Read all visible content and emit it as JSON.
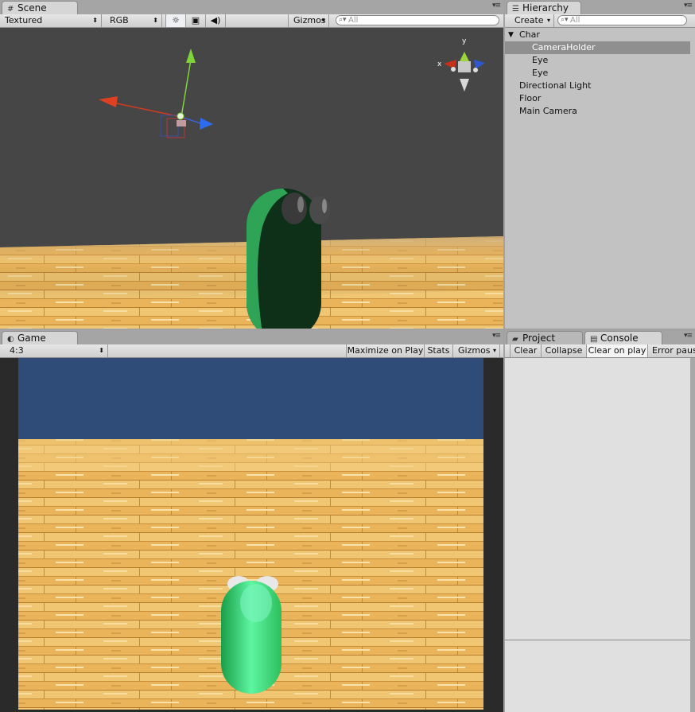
{
  "scene": {
    "tab_label": "Scene",
    "render_mode": "Textured",
    "color_mode": "RGB",
    "gizmos_label": "Gizmos",
    "search_placeholder": "All",
    "axis_x": "x",
    "axis_y": "y"
  },
  "hierarchy": {
    "tab_label": "Hierarchy",
    "create_label": "Create",
    "search_placeholder": "All",
    "items": [
      {
        "label": "Char",
        "indent": 0,
        "expanded": true
      },
      {
        "label": "CameraHolder",
        "indent": 1,
        "selected": true
      },
      {
        "label": "Eye",
        "indent": 1
      },
      {
        "label": "Eye",
        "indent": 1
      },
      {
        "label": "Directional Light",
        "indent": 0
      },
      {
        "label": "Floor",
        "indent": 0
      },
      {
        "label": "Main Camera",
        "indent": 0
      }
    ]
  },
  "game": {
    "tab_label": "Game",
    "aspect": "4:3",
    "maximize_label": "Maximize on Play",
    "stats_label": "Stats",
    "gizmos_label": "Gizmos"
  },
  "project": {
    "tab_label": "Project"
  },
  "console": {
    "tab_label": "Console",
    "clear_label": "Clear",
    "collapse_label": "Collapse",
    "clear_on_play_label": "Clear on play",
    "error_pause_label": "Error paus"
  },
  "colors": {
    "scene_bg": "#464646",
    "sky": "#2f4b78",
    "character": "#2fd36a",
    "selection": "#8f8f8f"
  }
}
